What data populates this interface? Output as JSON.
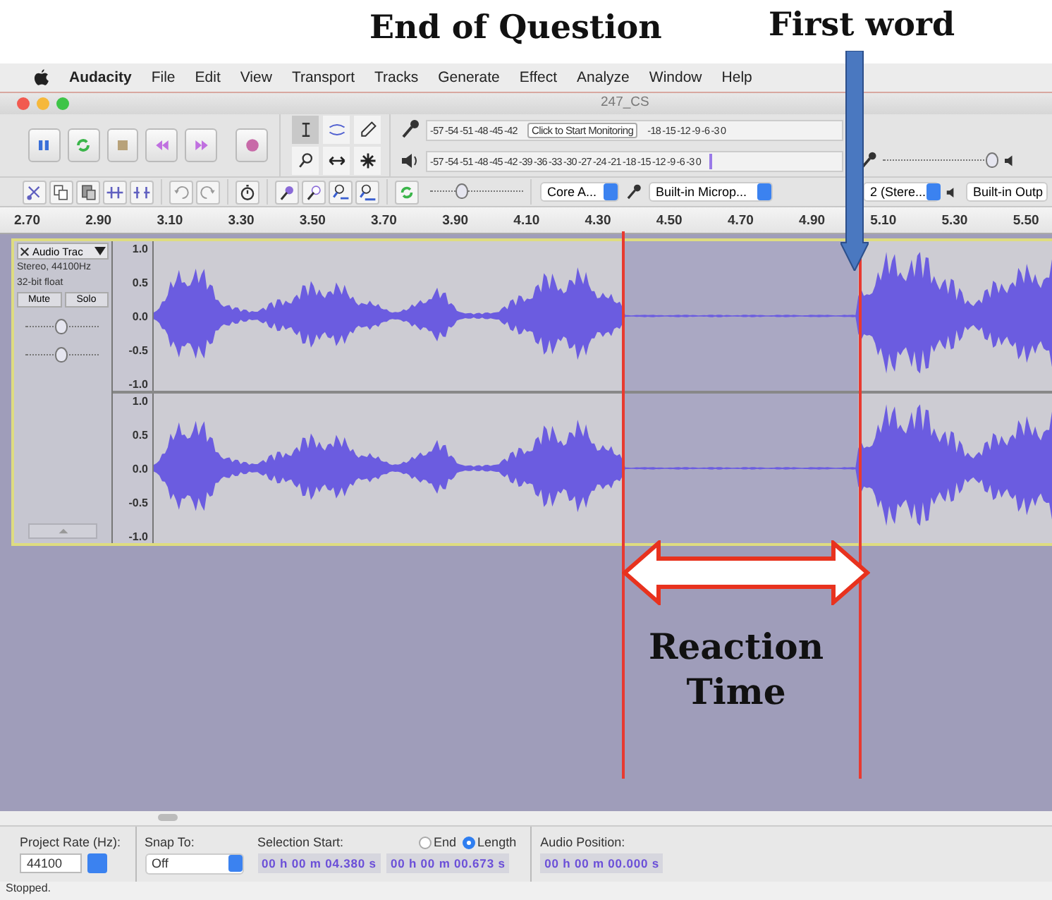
{
  "annotations": {
    "question": "End of Question",
    "first_word": "First word",
    "reaction": "Reaction Time"
  },
  "menu": [
    "Audacity",
    "File",
    "Edit",
    "View",
    "Transport",
    "Tracks",
    "Generate",
    "Effect",
    "Analyze",
    "Window",
    "Help"
  ],
  "window": {
    "title": "247_CS"
  },
  "record_meter": {
    "ticks_before": [
      "-57",
      "-54",
      "-51",
      "-48",
      "-45",
      "-42"
    ],
    "tooltip": "Click to Start Monitoring",
    "ticks_after": [
      "-18",
      "-15",
      "-12",
      "-9",
      "-6",
      "-3",
      "0"
    ]
  },
  "playback_meter": {
    "ticks": [
      "-57",
      "-54",
      "-51",
      "-48",
      "-45",
      "-42",
      "-39",
      "-36",
      "-33",
      "-30",
      "-27",
      "-24",
      "-21",
      "-18",
      "-15",
      "-12",
      "-9",
      "-6",
      "-3",
      "0"
    ]
  },
  "speed_slider": {
    "level": 0.35
  },
  "volume_slider": {
    "level": 0.95
  },
  "devices": {
    "host": "Core A...",
    "input": "Built-in Microp...",
    "channels": "2 (Stere...",
    "output": "Built-in Outp"
  },
  "ruler": [
    "2.70",
    "2.90",
    "3.10",
    "3.30",
    "3.50",
    "3.70",
    "3.90",
    "4.10",
    "4.30",
    "4.50",
    "4.70",
    "4.90",
    "5.10",
    "5.30",
    "5.50"
  ],
  "track": {
    "name": "Audio Trac",
    "info": [
      "Stereo, 44100Hz",
      "32-bit float"
    ],
    "buttons": [
      "Mute",
      "Solo"
    ],
    "gain": {
      "level": 0.5
    },
    "pan": {
      "level": 0.5
    },
    "channels": [
      {
        "scale": [
          "1.0",
          "0.5",
          "0.0",
          "-0.5",
          "-1.0"
        ]
      },
      {
        "scale": [
          "1.0",
          "0.5",
          "0.0",
          "-0.5",
          "-1.0"
        ]
      }
    ]
  },
  "selection_bar": {
    "rate_label": "Project Rate (Hz):",
    "rate": "44100",
    "snap_label": "Snap To:",
    "snap": "Off",
    "start_label": "Selection Start:",
    "modes": [
      {
        "label": "End",
        "selected": false
      },
      {
        "label": "Length",
        "selected": true
      }
    ],
    "position_label": "Audio Position:",
    "start": "00 h 00 m 04.380 s",
    "length": "00 h 00 m 00.673 s",
    "position": "00 h 00 m 00.000 s"
  },
  "status_bar": "Stopped."
}
